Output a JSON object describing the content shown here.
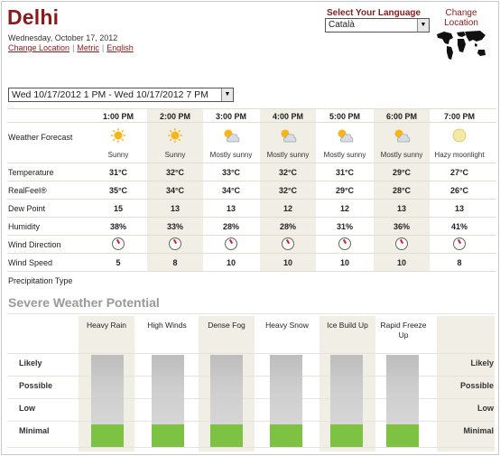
{
  "location": {
    "city": "Delhi",
    "date": "Wednesday, October 17, 2012"
  },
  "links": {
    "change_location": "Change Location",
    "metric": "Metric",
    "english": "English",
    "separator": "|"
  },
  "language": {
    "label": "Select Your Language",
    "selected": "Català"
  },
  "change_location_map": {
    "label": "Change Location",
    "icon": "world-map-icon"
  },
  "range_select": {
    "selected": "Wed 10/17/2012 1 PM - Wed 10/17/2012 7 PM"
  },
  "forecast": {
    "times": [
      "1:00 PM",
      "2:00 PM",
      "3:00 PM",
      "4:00 PM",
      "5:00 PM",
      "6:00 PM",
      "7:00 PM"
    ],
    "row_labels": {
      "weather": "Weather Forecast",
      "temperature": "Temperature",
      "realfeel": "RealFeel®",
      "dewpoint": "Dew Point",
      "humidity": "Humidity",
      "wind_direction": "Wind Direction",
      "wind_speed": "Wind Speed",
      "precipitation": "Precipitation Type"
    },
    "conditions": [
      "Sunny",
      "Sunny",
      "Mostly sunny",
      "Mostly sunny",
      "Mostly sunny",
      "Mostly sunny",
      "Hazy moonlight"
    ],
    "condition_icons": [
      "sun-icon",
      "sun-icon",
      "partly-sunny-icon",
      "partly-sunny-icon",
      "partly-sunny-icon",
      "partly-sunny-icon",
      "hazy-moon-icon"
    ],
    "temperature": [
      "31°C",
      "32°C",
      "33°C",
      "32°C",
      "31°C",
      "29°C",
      "27°C"
    ],
    "realfeel": [
      "35°C",
      "34°C",
      "34°C",
      "32°C",
      "29°C",
      "28°C",
      "26°C"
    ],
    "dewpoint": [
      "15",
      "13",
      "13",
      "12",
      "12",
      "13",
      "13"
    ],
    "humidity": [
      "38%",
      "33%",
      "28%",
      "28%",
      "31%",
      "36%",
      "41%"
    ],
    "wind_speed": [
      "5",
      "8",
      "10",
      "10",
      "10",
      "10",
      "8"
    ]
  },
  "severe": {
    "title": "Severe Weather Potential",
    "categories": [
      "Heavy Rain",
      "High Winds",
      "Dense Fog",
      "Heavy Snow",
      "Ice Build Up",
      "Rapid Freeze Up"
    ],
    "levels": [
      "Likely",
      "Possible",
      "Low",
      "Minimal"
    ],
    "current_level": "Minimal"
  },
  "colors": {
    "brand": "#8b1a1a",
    "shade": "#f1eee6",
    "minimal_green": "#7dc242",
    "sun": "#f7b51d"
  }
}
